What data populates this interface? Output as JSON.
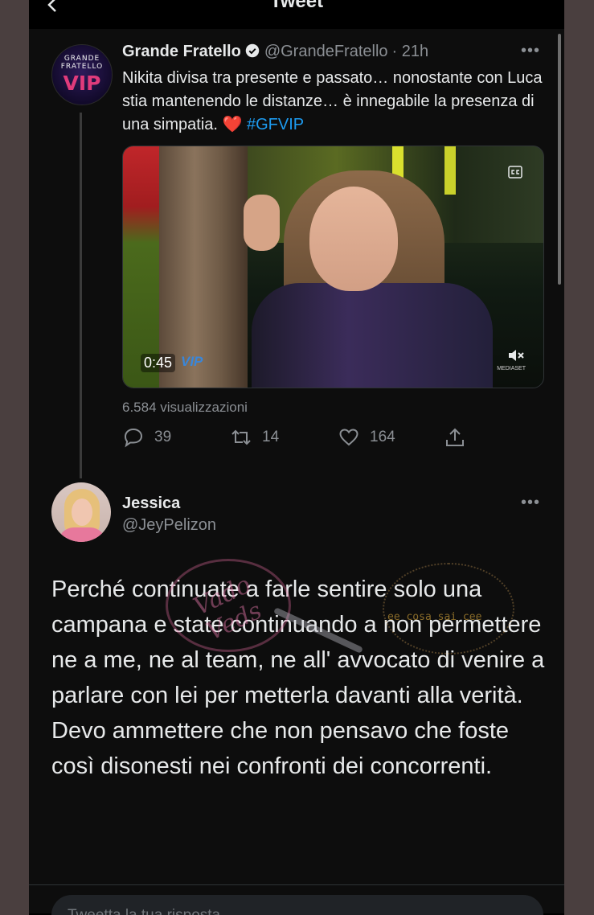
{
  "header": {
    "title": "Tweet"
  },
  "tweet": {
    "display_name": "Grande Fratello",
    "handle": "@GrandeFratello",
    "time": "· 21h",
    "avatar_logo_text": "GRANDE FRATELLO",
    "avatar_logo_vip": "VIP",
    "text_part": "Nikita divisa tra presente e passato… nonostante con Luca stia mantenendo le distanze… è innegabile la presenza di una simpatia. ",
    "emoji": "❤️",
    "hashtag": "#GFVIP",
    "video": {
      "duration": "0:45",
      "badge": "VIP",
      "watermark": "MEDIASET"
    },
    "views": "6.584 visualizzazioni",
    "stats": {
      "replies": "39",
      "retweets": "14",
      "likes": "164"
    },
    "more": "•••"
  },
  "reply": {
    "display_name": "Jessica",
    "handle": "@JeyPelizon",
    "more": "•••",
    "text": "Perché continuate a farle sentire solo una campana e state continuando a non permettere ne a me, ne al team, ne all' avvocato di venire a parlare con lei per metterla davanti alla verità. Devo ammettere che non pensavo che foste così disonesti nei confronti dei concorrenti."
  },
  "watermarks": {
    "left": "Vado Veds",
    "right": "ee cosa sai cee"
  },
  "composer": {
    "placeholder": "Tweetta la tua risposta"
  },
  "colors": {
    "accent": "#1d9bf0",
    "background": "#000000",
    "muted": "#8b8f94"
  }
}
